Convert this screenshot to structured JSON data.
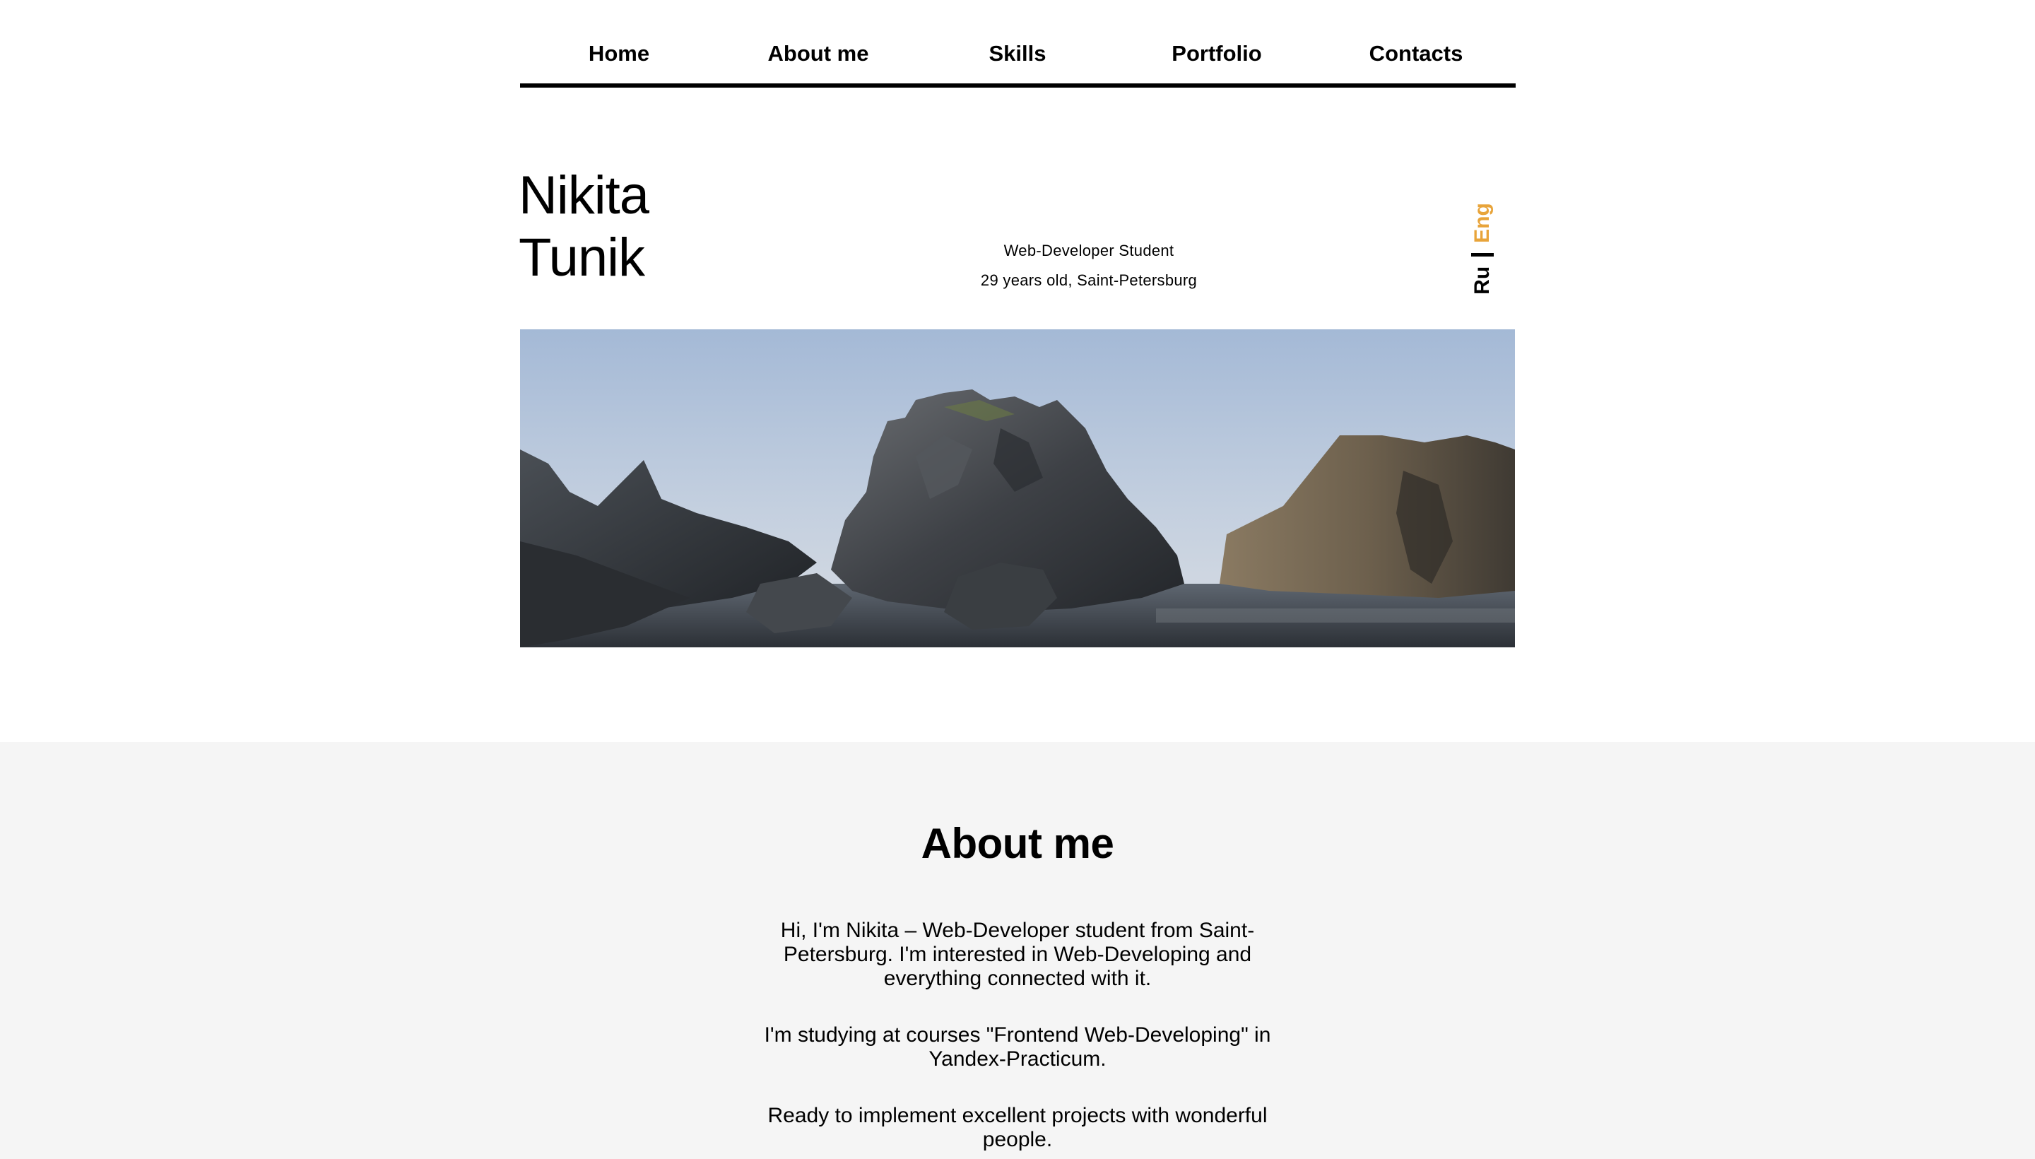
{
  "nav": {
    "items": [
      {
        "label": "Home"
      },
      {
        "label": "About me"
      },
      {
        "label": "Skills"
      },
      {
        "label": "Portfolio"
      },
      {
        "label": "Contacts"
      }
    ]
  },
  "hero": {
    "first_name": "Nikita",
    "last_name": "Tunik",
    "role": "Web-Developer Student",
    "details": "29 years old, Saint-Petersburg",
    "image_icon": "rocky-coast-landscape-photo"
  },
  "language": {
    "ru": "Ru",
    "eng": "Eng",
    "active": "Eng",
    "active_color": "#e8a43a"
  },
  "about": {
    "title": "About me",
    "paragraphs": [
      "Hi, I'm Nikita – Web-Developer student from Saint-Petersburg. I'm interested in Web-Developing and everything connected with it.",
      "I'm studying at courses \"Frontend Web-Developing\" in Yandex-Practicum.",
      "Ready to implement excellent projects with wonderful people."
    ],
    "background_color": "#f5f5f5"
  }
}
